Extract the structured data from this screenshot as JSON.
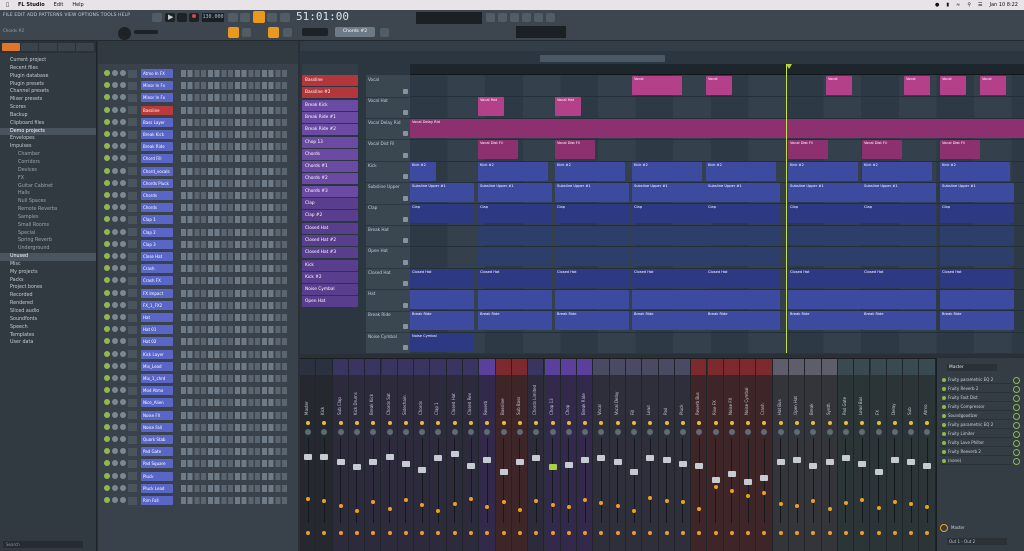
{
  "mac_menubar": {
    "app": "FL Studio",
    "items": [
      "Edit",
      "Help"
    ],
    "clock": "Jan 10 8:22"
  },
  "fl_menu": "FILE EDIT ADD PATTERNS VIEW OPTIONS TOOLS HELP",
  "transport": {
    "tempo": "130.000",
    "time": "51:01:00",
    "pattern": "Chords #2",
    "hint_label": "Chords #2"
  },
  "browser": {
    "search_placeholder": "Search",
    "items": [
      {
        "label": "Current project",
        "sub": false
      },
      {
        "label": "Recent files",
        "sub": false
      },
      {
        "label": "Plugin database",
        "sub": false
      },
      {
        "label": "Plugin presets",
        "sub": false
      },
      {
        "label": "Channel presets",
        "sub": false
      },
      {
        "label": "Mixer presets",
        "sub": false
      },
      {
        "label": "Scores",
        "sub": false
      },
      {
        "label": "Backup",
        "sub": false
      },
      {
        "label": "Clipboard files",
        "sub": false
      },
      {
        "label": "Demo projects",
        "sub": false,
        "sel": true
      },
      {
        "label": "Envelopes",
        "sub": false
      },
      {
        "label": "Impulses",
        "sub": false
      },
      {
        "label": "Chamber",
        "sub": true
      },
      {
        "label": "Corridors",
        "sub": true
      },
      {
        "label": "Devices",
        "sub": true
      },
      {
        "label": "FX",
        "sub": true
      },
      {
        "label": "Guitar Cabinet",
        "sub": true
      },
      {
        "label": "Halls",
        "sub": true
      },
      {
        "label": "Null Spaces",
        "sub": true
      },
      {
        "label": "Remote Reverbs",
        "sub": true
      },
      {
        "label": "Samples",
        "sub": true
      },
      {
        "label": "Small Rooms",
        "sub": true
      },
      {
        "label": "Special",
        "sub": true
      },
      {
        "label": "Spring Reverb",
        "sub": true
      },
      {
        "label": "Underground",
        "sub": true
      },
      {
        "label": "Unused",
        "sub": false,
        "sel": true
      },
      {
        "label": "Misc",
        "sub": false
      },
      {
        "label": "My projects",
        "sub": false
      },
      {
        "label": "Packs",
        "sub": false
      },
      {
        "label": "Project bones",
        "sub": false
      },
      {
        "label": "Recorded",
        "sub": false
      },
      {
        "label": "Rendered",
        "sub": false
      },
      {
        "label": "Sliced audio",
        "sub": false
      },
      {
        "label": "Soundfonts",
        "sub": false
      },
      {
        "label": "Speech",
        "sub": false
      },
      {
        "label": "Templates",
        "sub": false
      },
      {
        "label": "User data",
        "sub": false
      }
    ]
  },
  "rack": {
    "channels": [
      {
        "name": "Atmo In FX",
        "num": "",
        "color": "blue"
      },
      {
        "name": "Minor In Fx",
        "num": "",
        "color": "blue"
      },
      {
        "name": "Minor In Fx",
        "num": "",
        "color": "blue"
      },
      {
        "name": "Bassline",
        "num": "",
        "color": "red"
      },
      {
        "name": "Bass Layer",
        "num": "",
        "color": "blue"
      },
      {
        "name": "Break Kick",
        "num": "",
        "color": "blue"
      },
      {
        "name": "Break Ride",
        "num": "",
        "color": "blue"
      },
      {
        "name": "Chord Fill",
        "num": "",
        "color": "blue"
      },
      {
        "name": "Chord_vocals",
        "num": "",
        "color": "blue"
      },
      {
        "name": "Chords Pluck",
        "num": "",
        "color": "blue"
      },
      {
        "name": "Chords",
        "num": "",
        "color": "blue"
      },
      {
        "name": "Chords",
        "num": "",
        "color": "blue"
      },
      {
        "name": "Clap 1",
        "num": "",
        "color": "blue"
      },
      {
        "name": "Clap 2",
        "num": "",
        "color": "blue"
      },
      {
        "name": "Clap 3",
        "num": "",
        "color": "blue"
      },
      {
        "name": "Close Hat",
        "num": "",
        "color": "blue"
      },
      {
        "name": "Crash",
        "num": "",
        "color": "blue"
      },
      {
        "name": "Crash FX",
        "num": "",
        "color": "blue"
      },
      {
        "name": "FX Impact",
        "num": "",
        "color": "blue"
      },
      {
        "name": "FX_1_FX2",
        "num": "",
        "color": "blue"
      },
      {
        "name": "Hat",
        "num": "",
        "color": "blue"
      },
      {
        "name": "Hat 01",
        "num": "",
        "color": "blue"
      },
      {
        "name": "Hat 02",
        "num": "",
        "color": "blue"
      },
      {
        "name": "Kick Layer",
        "num": "",
        "color": "blue"
      },
      {
        "name": "Mix_Lead",
        "num": "",
        "color": "blue"
      },
      {
        "name": "Mix_1_chrd",
        "num": "",
        "color": "blue"
      },
      {
        "name": "Mod Atmo",
        "num": "",
        "color": "blue"
      },
      {
        "name": "Nice_Alien",
        "num": "",
        "color": "blue"
      },
      {
        "name": "Noise FX",
        "num": "",
        "color": "blue"
      },
      {
        "name": "Noise Fall",
        "num": "",
        "color": "blue"
      },
      {
        "name": "Quark Stab",
        "num": "",
        "color": "blue"
      },
      {
        "name": "Pad Gate",
        "num": "",
        "color": "blue"
      },
      {
        "name": "Pad Square",
        "num": "",
        "color": "blue"
      },
      {
        "name": "Pluck",
        "num": "",
        "color": "blue"
      },
      {
        "name": "Pluck Lead",
        "num": "",
        "color": "blue"
      },
      {
        "name": "Rim Fall",
        "num": "",
        "color": "blue"
      }
    ]
  },
  "pattern_list": [
    {
      "name": "Bassline",
      "color": "#b2363b"
    },
    {
      "name": "Bassline #2",
      "color": "#b2363b"
    },
    {
      "name": "Break Kick",
      "color": "#6a4aa2"
    },
    {
      "name": "Break Ride #1",
      "color": "#6a4aa2"
    },
    {
      "name": "Break Ride #2",
      "color": "#6a4aa2"
    },
    {
      "name": "Chop 13",
      "color": "#6a4aa2"
    },
    {
      "name": "Chords",
      "color": "#6a4aa2"
    },
    {
      "name": "Chords #1",
      "color": "#6a4aa2"
    },
    {
      "name": "Chords #2",
      "color": "#6a4aa2"
    },
    {
      "name": "Chords #3",
      "color": "#6a4aa2"
    },
    {
      "name": "Clap",
      "color": "#5a3e8e"
    },
    {
      "name": "Clap #2",
      "color": "#5a3e8e"
    },
    {
      "name": "Closed Hat",
      "color": "#5a3e8e"
    },
    {
      "name": "Closed Hat #2",
      "color": "#5a3e8e"
    },
    {
      "name": "Closed Hat #3",
      "color": "#5a3e8e"
    },
    {
      "name": "Kick",
      "color": "#5a3e8e"
    },
    {
      "name": "Kick #2",
      "color": "#5a3e8e"
    },
    {
      "name": "Noise Cymbal",
      "color": "#5a3e8e"
    },
    {
      "name": "Open Hat",
      "color": "#5a3e8e"
    }
  ],
  "tracks": [
    "Vocal",
    "Vocal Hat",
    "Vocal Delay Rid",
    "Vocal Dist Fil",
    "Kick",
    "Subsline Upper",
    "Clap",
    "Break Hat",
    "Open Hat",
    "Closed Hat",
    "Hat",
    "Break Ride",
    "Noise Cymbal"
  ],
  "clips": {
    "vocal": "Vocal",
    "vocal_hat": "Vocal Hat",
    "vocal_delay": "Vocal Delay Rid",
    "vocal_dist": "Vocal Dist Fil",
    "kick": "Kick #2",
    "sub": "Subsline Upper #1",
    "clap": "Clap",
    "closed": "Closed Hat",
    "ride": "Break Ride",
    "noise": "Noise Cymbal"
  },
  "mixer": {
    "tracks": [
      "Master",
      "Kick",
      "Sub Clap",
      "Kick Drums",
      "Break Kick",
      "Chords Sat",
      "Sidechain",
      "Chords",
      "Clap 1",
      "Closed Hat",
      "Closed Rev",
      "Reverb",
      "Bassline",
      "Sub Bass",
      "Chords Limited",
      "Chop 13",
      "Chop",
      "Break Ride",
      "Vocal",
      "Vocal Delay",
      "Fill",
      "Lead",
      "Pad",
      "Pluck",
      "Reverb Bus",
      "Rise FX",
      "Noise FX",
      "Noise Cymbal",
      "Crash",
      "Hat Bus",
      "Open Hat",
      "Break",
      "Synth",
      "Pad Gate",
      "Lead Bus",
      "FX",
      "Delay",
      "Sub",
      "Atmo"
    ]
  },
  "fx_panel": {
    "title": "Master",
    "slots": [
      "Fruity parametric EQ 2",
      "Fruity Reverb 2",
      "Fruity Fast Dist",
      "Fruity Compressor",
      "Soundgoodizer",
      "Fruity parametric EQ 2",
      "Fruity Limiter",
      "Fruity Love Philter",
      "Fruity Reeverb 2",
      "(none)"
    ],
    "out_label": "Master",
    "out_select": "Out 1 - Out 2"
  },
  "colors": {
    "accent": "#e99a1e",
    "rack_blue": "#5a66c6",
    "mixer_purple": "#5a3f9c",
    "mixer_red": "#7d2a2f"
  }
}
